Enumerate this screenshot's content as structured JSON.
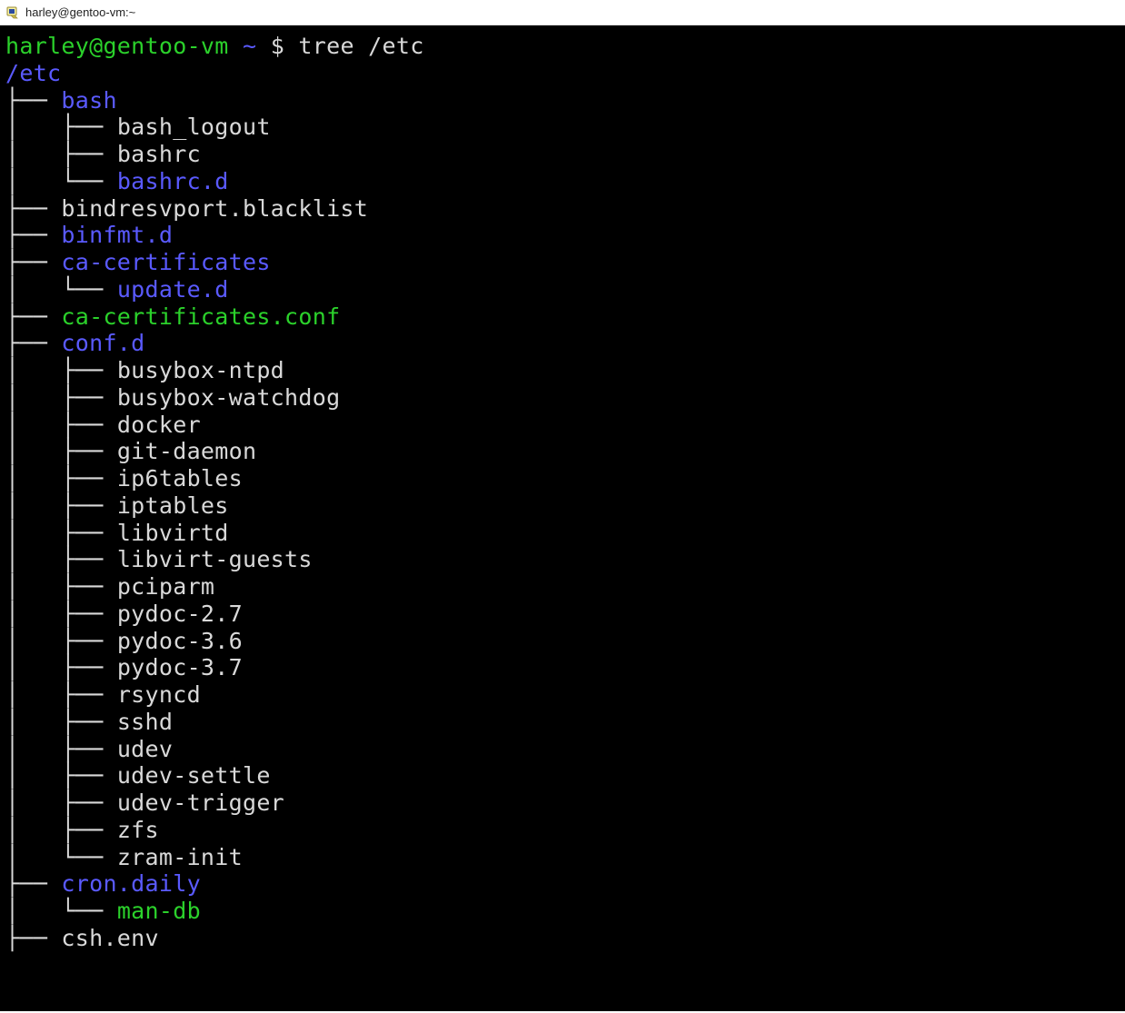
{
  "window": {
    "title": "harley@gentoo-vm:~"
  },
  "prompt": {
    "userhost": "harley@gentoo-vm",
    "tilde": "~",
    "dollar": "$",
    "command": "tree /etc"
  },
  "tree": {
    "root": "/etc",
    "lines": [
      {
        "prefix": "├── ",
        "type": "dir",
        "name": "bash"
      },
      {
        "prefix": "│   ├── ",
        "type": "file",
        "name": "bash_logout"
      },
      {
        "prefix": "│   ├── ",
        "type": "file",
        "name": "bashrc"
      },
      {
        "prefix": "│   └── ",
        "type": "dir",
        "name": "bashrc.d"
      },
      {
        "prefix": "├── ",
        "type": "file",
        "name": "bindresvport.blacklist"
      },
      {
        "prefix": "├── ",
        "type": "dir",
        "name": "binfmt.d"
      },
      {
        "prefix": "├── ",
        "type": "dir",
        "name": "ca-certificates"
      },
      {
        "prefix": "│   └── ",
        "type": "dir",
        "name": "update.d"
      },
      {
        "prefix": "├── ",
        "type": "exec",
        "name": "ca-certificates.conf"
      },
      {
        "prefix": "├── ",
        "type": "dir",
        "name": "conf.d"
      },
      {
        "prefix": "│   ├── ",
        "type": "file",
        "name": "busybox-ntpd"
      },
      {
        "prefix": "│   ├── ",
        "type": "file",
        "name": "busybox-watchdog"
      },
      {
        "prefix": "│   ├── ",
        "type": "file",
        "name": "docker"
      },
      {
        "prefix": "│   ├── ",
        "type": "file",
        "name": "git-daemon"
      },
      {
        "prefix": "│   ├── ",
        "type": "file",
        "name": "ip6tables"
      },
      {
        "prefix": "│   ├── ",
        "type": "file",
        "name": "iptables"
      },
      {
        "prefix": "│   ├── ",
        "type": "file",
        "name": "libvirtd"
      },
      {
        "prefix": "│   ├── ",
        "type": "file",
        "name": "libvirt-guests"
      },
      {
        "prefix": "│   ├── ",
        "type": "file",
        "name": "pciparm"
      },
      {
        "prefix": "│   ├── ",
        "type": "file",
        "name": "pydoc-2.7"
      },
      {
        "prefix": "│   ├── ",
        "type": "file",
        "name": "pydoc-3.6"
      },
      {
        "prefix": "│   ├── ",
        "type": "file",
        "name": "pydoc-3.7"
      },
      {
        "prefix": "│   ├── ",
        "type": "file",
        "name": "rsyncd"
      },
      {
        "prefix": "│   ├── ",
        "type": "file",
        "name": "sshd"
      },
      {
        "prefix": "│   ├── ",
        "type": "file",
        "name": "udev"
      },
      {
        "prefix": "│   ├── ",
        "type": "file",
        "name": "udev-settle"
      },
      {
        "prefix": "│   ├── ",
        "type": "file",
        "name": "udev-trigger"
      },
      {
        "prefix": "│   ├── ",
        "type": "file",
        "name": "zfs"
      },
      {
        "prefix": "│   └── ",
        "type": "file",
        "name": "zram-init"
      },
      {
        "prefix": "├── ",
        "type": "dir",
        "name": "cron.daily"
      },
      {
        "prefix": "│   └── ",
        "type": "exec",
        "name": "man-db"
      },
      {
        "prefix": "├── ",
        "type": "file",
        "name": "csh.env"
      }
    ]
  }
}
